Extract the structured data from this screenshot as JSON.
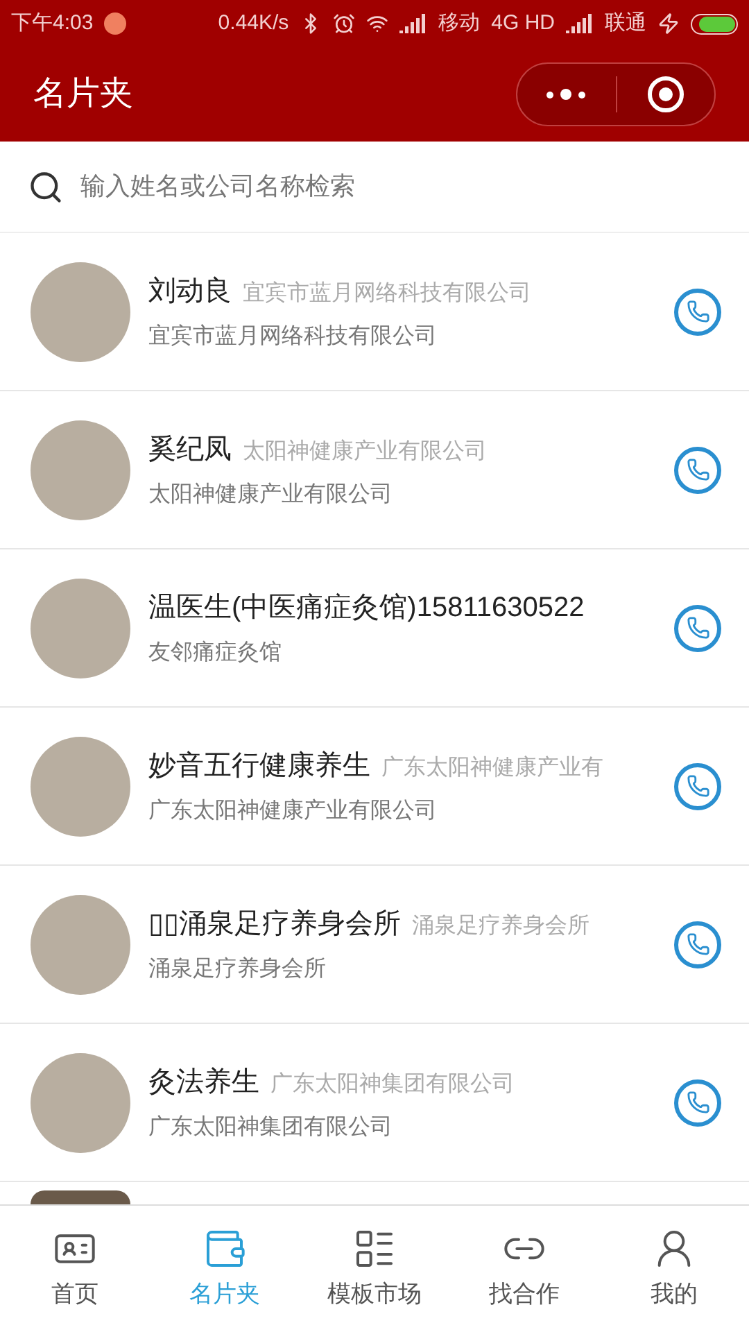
{
  "status_bar": {
    "time": "下午4:03",
    "speed": "0.44K/s",
    "carrier1": "移动",
    "network": "4G HD",
    "carrier2": "联通"
  },
  "header": {
    "title": "名片夹"
  },
  "search": {
    "placeholder": "输入姓名或公司名称检索"
  },
  "contacts": [
    {
      "name": "刘动良",
      "company_short": "宜宾市蓝月网络科技有限公司",
      "company": "宜宾市蓝月网络科技有限公司"
    },
    {
      "name": "奚纪凤",
      "company_short": "太阳神健康产业有限公司",
      "company": "太阳神健康产业有限公司"
    },
    {
      "name": "温医生(中医痛症灸馆)15811630522",
      "company": "友邻痛症灸馆"
    },
    {
      "name": "妙音五行健康养生",
      "company_short": "广东太阳神健康产业有",
      "company": "广东太阳神健康产业有限公司"
    },
    {
      "name": "▯▯涌泉足疗养身会所",
      "company_short": "涌泉足疗养身会所",
      "company": "涌泉足疗养身会所"
    },
    {
      "name": "灸法养生",
      "company_short": "广东太阳神集团有限公司",
      "company": "广东太阳神集团有限公司"
    }
  ],
  "tabs": [
    {
      "label": "首页",
      "kind": "home",
      "selected": false
    },
    {
      "label": "名片夹",
      "kind": "wallet",
      "selected": true
    },
    {
      "label": "模板市场",
      "kind": "template",
      "selected": false
    },
    {
      "label": "找合作",
      "kind": "partner",
      "selected": false
    },
    {
      "label": "我的",
      "kind": "user",
      "selected": false
    }
  ]
}
